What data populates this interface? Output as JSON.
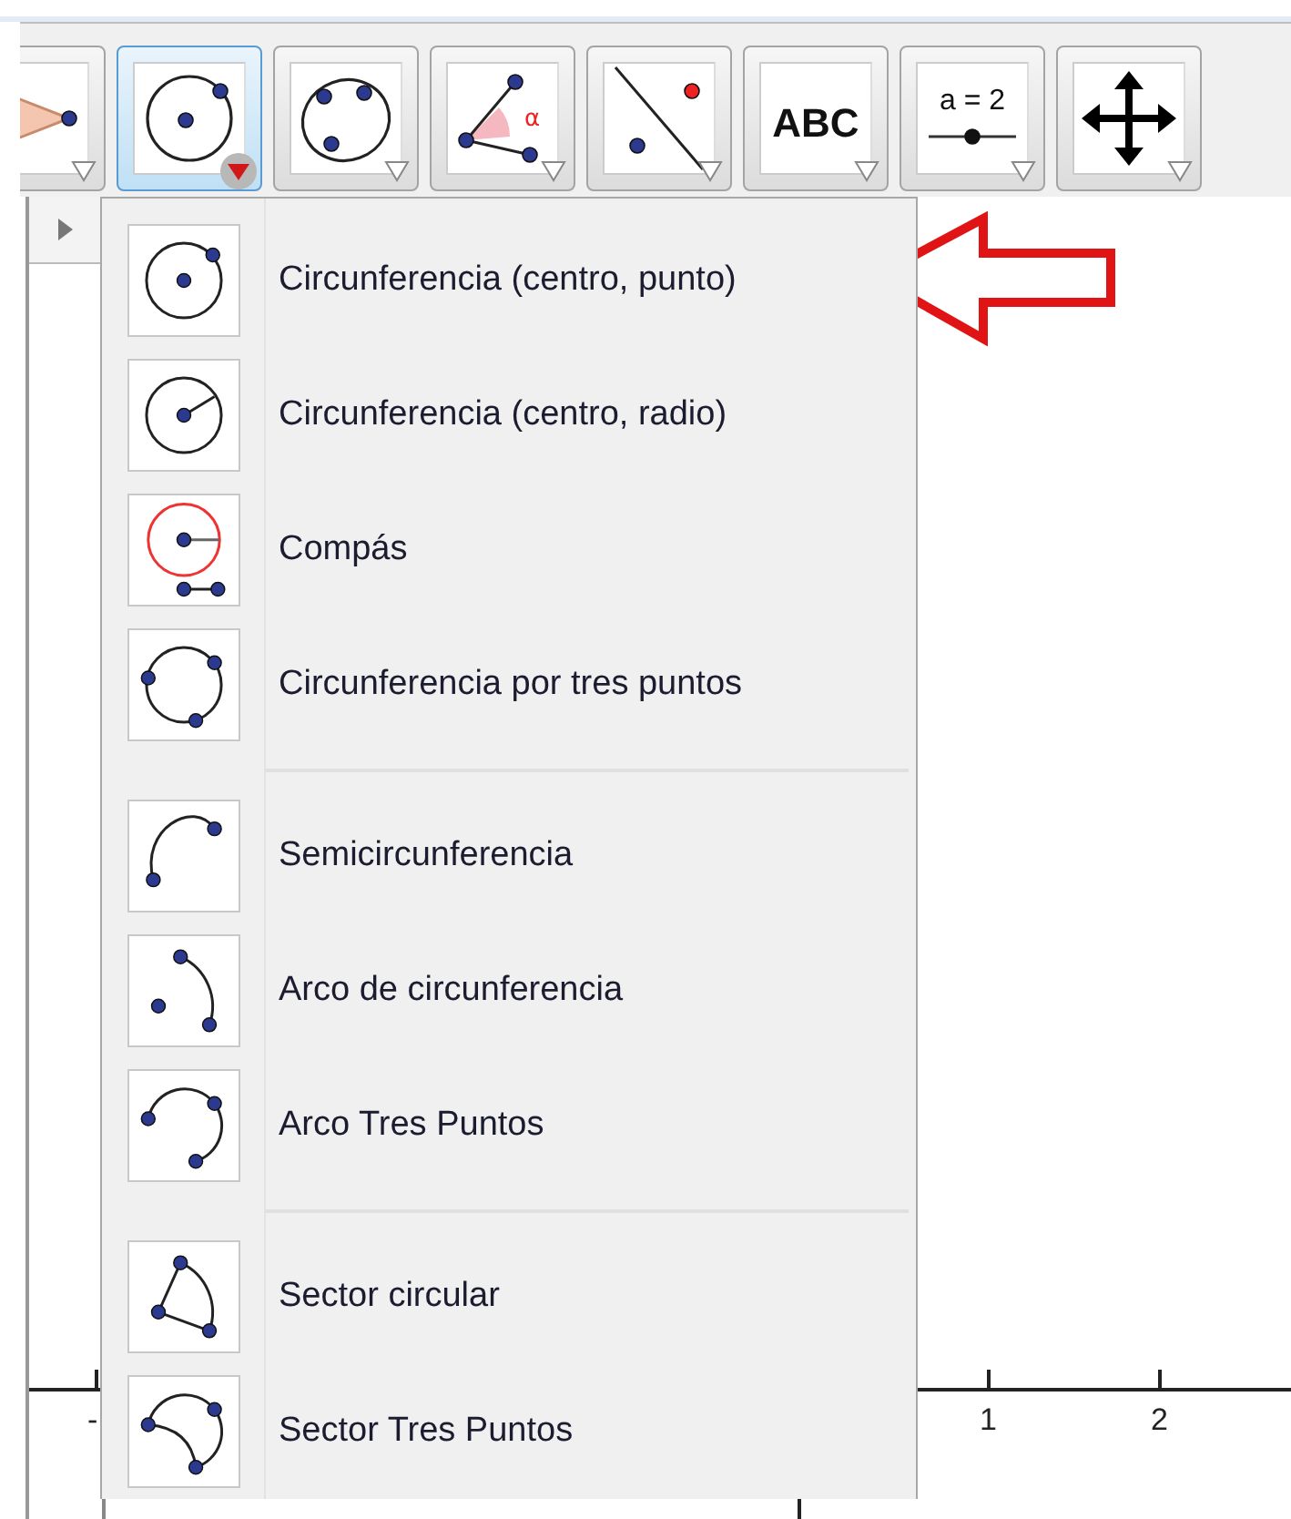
{
  "toolbar": {
    "tools": [
      {
        "selected": false
      },
      {
        "selected": true
      },
      {
        "selected": false
      },
      {
        "selected": false,
        "label": "α"
      },
      {
        "selected": false
      },
      {
        "selected": false,
        "label": "ABC"
      },
      {
        "selected": false,
        "label": "a = 2"
      },
      {
        "selected": false
      }
    ]
  },
  "graphics": {
    "x_axis_labels": [
      "-",
      "1",
      "2"
    ]
  },
  "menu": {
    "groups": [
      {
        "items": [
          {
            "label": "Circunferencia (centro, punto)"
          },
          {
            "label": "Circunferencia (centro, radio)"
          },
          {
            "label": "Compás"
          },
          {
            "label": "Circunferencia por tres puntos"
          }
        ]
      },
      {
        "items": [
          {
            "label": "Semicircunferencia"
          },
          {
            "label": "Arco de circunferencia"
          },
          {
            "label": "Arco Tres Puntos"
          }
        ]
      },
      {
        "items": [
          {
            "label": "Sector circular"
          },
          {
            "label": "Sector Tres Puntos"
          }
        ]
      }
    ]
  }
}
